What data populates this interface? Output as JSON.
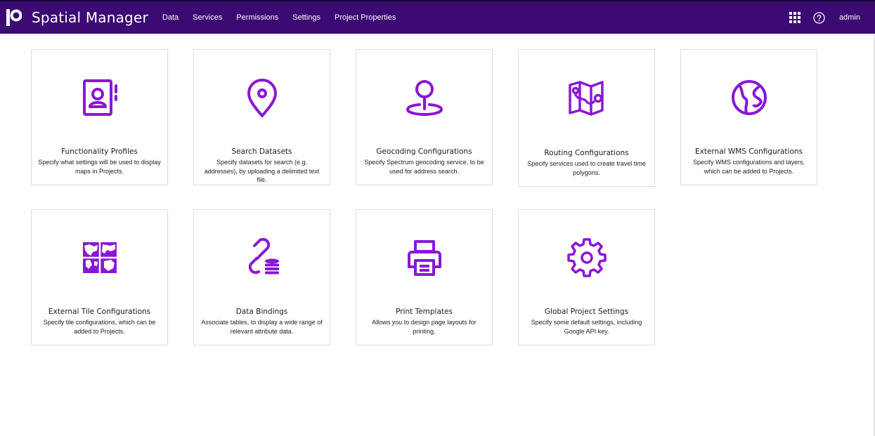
{
  "header": {
    "brand": "Spatial Manager",
    "nav": [
      "Data",
      "Services",
      "Permissions",
      "Settings",
      "Project Properties"
    ],
    "user": "admin",
    "background_color": "#3b0a73"
  },
  "accent_color": "#8a16d8",
  "cards": [
    {
      "title": "Functionality Profiles",
      "description": "Specify what settings will be used to display maps in Projects.",
      "icon": "contact-book-icon"
    },
    {
      "title": "Search Datasets",
      "description": "Specify datasets for search (e.g. addresses), by uploading a delimited text file.",
      "icon": "location-pin-icon"
    },
    {
      "title": "Geocoding Configurations",
      "description": "Specify Spectrum geocoding service, to be used for address search.",
      "icon": "map-marker-icon"
    },
    {
      "title": "Routing Configurations",
      "description": "Specify services used to create travel time polygons.",
      "icon": "route-map-icon"
    },
    {
      "title": "External WMS Configurations",
      "description": "Specify WMS configurations and layers, which can be added to Projects.",
      "icon": "globe-icon"
    },
    {
      "title": "External Tile Configurations",
      "description": "Specify tile configurations, which can be added to Projects.",
      "icon": "tile-map-icon"
    },
    {
      "title": "Data Bindings",
      "description": "Associate tables, to display a wide range of relevant attribute data.",
      "icon": "link-database-icon"
    },
    {
      "title": "Print Templates",
      "description": "Allows you to design page layouts for printing.",
      "icon": "printer-icon"
    },
    {
      "title": "Global Project Settings",
      "description": "Specify some default settings, including Google API key.",
      "icon": "gear-icon"
    }
  ]
}
